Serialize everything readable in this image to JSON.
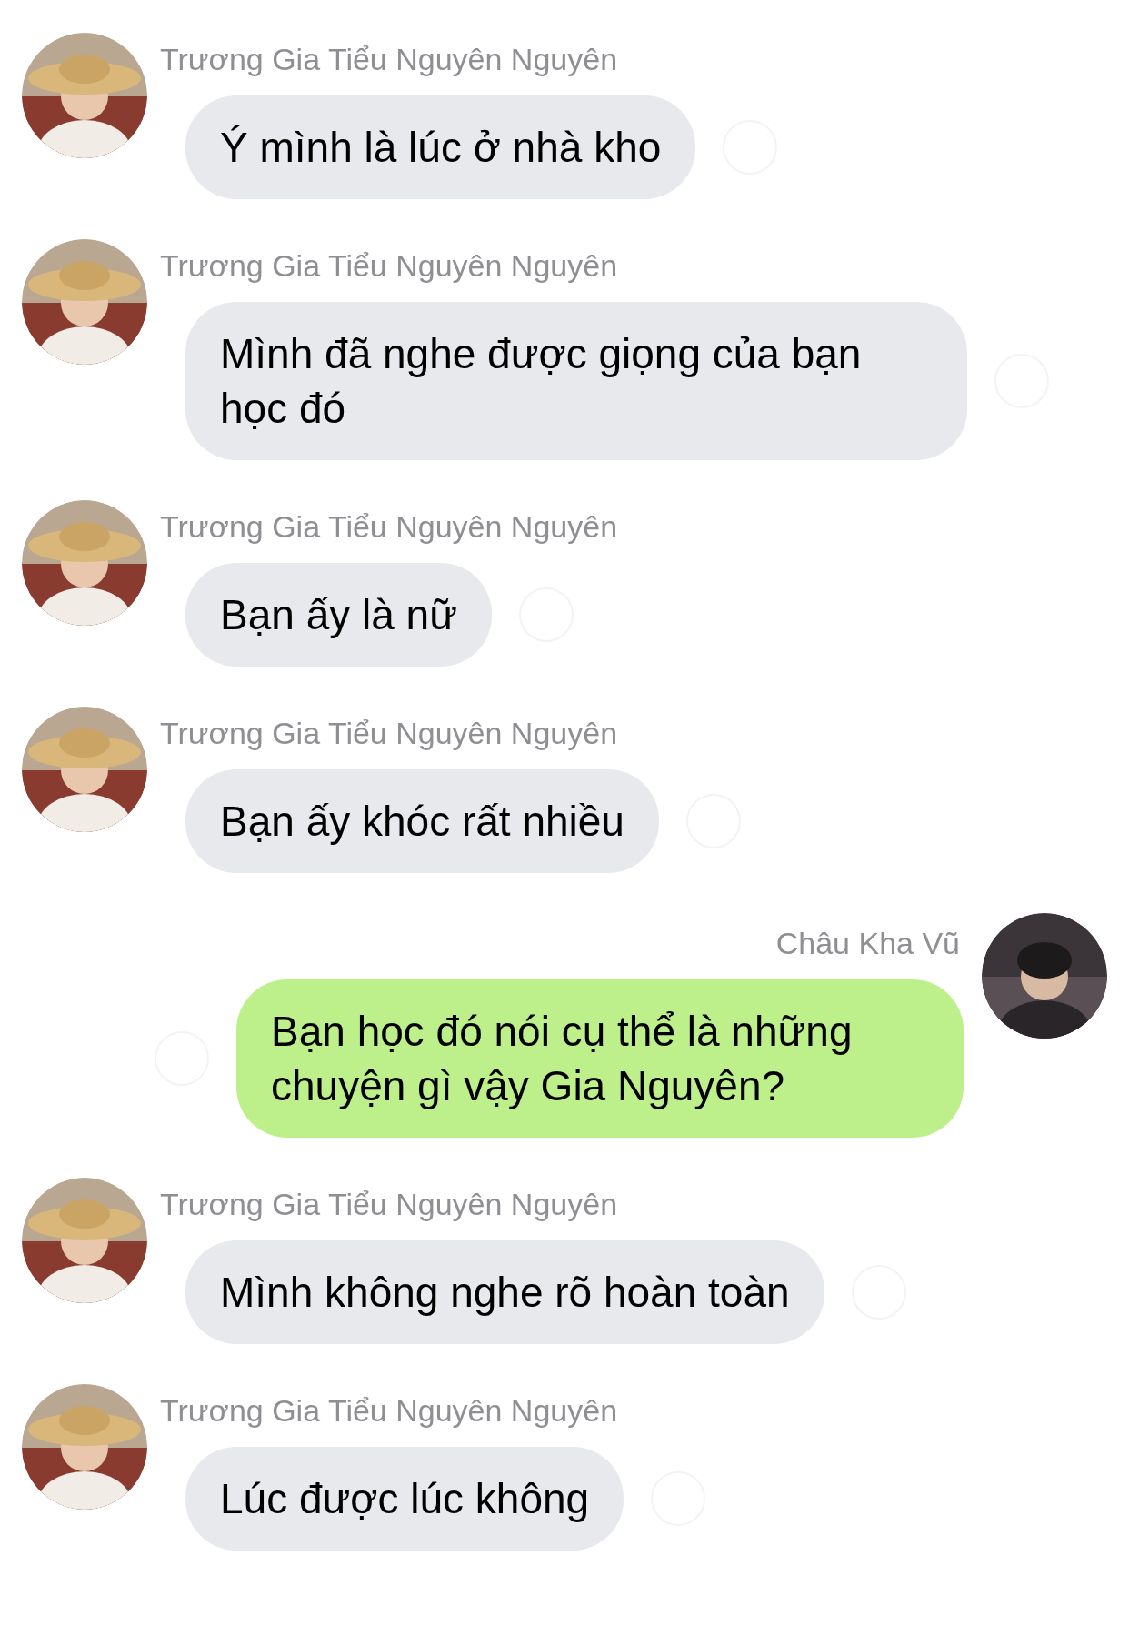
{
  "messages": [
    {
      "kind": "received",
      "sender": "Trương Gia Tiểu Nguyên Nguyên",
      "text": "Ý mình là lúc ở nhà kho"
    },
    {
      "kind": "received",
      "sender": "Trương Gia Tiểu Nguyên Nguyên",
      "text": "Mình đã nghe được giọng của bạn học đó"
    },
    {
      "kind": "received",
      "sender": "Trương Gia Tiểu Nguyên Nguyên",
      "text": "Bạn ấy là nữ"
    },
    {
      "kind": "received",
      "sender": "Trương Gia Tiểu Nguyên Nguyên",
      "text": "Bạn ấy khóc rất nhiều"
    },
    {
      "kind": "sent",
      "sender": "Châu Kha Vũ",
      "text": "Bạn học đó nói cụ thể là những chuyện gì vậy Gia Nguyên?"
    },
    {
      "kind": "received",
      "sender": "Trương Gia Tiểu Nguyên Nguyên",
      "text": "Mình không nghe rõ hoàn toàn"
    },
    {
      "kind": "received",
      "sender": "Trương Gia Tiểu Nguyên Nguyên",
      "text": "Lúc được lúc không"
    }
  ]
}
